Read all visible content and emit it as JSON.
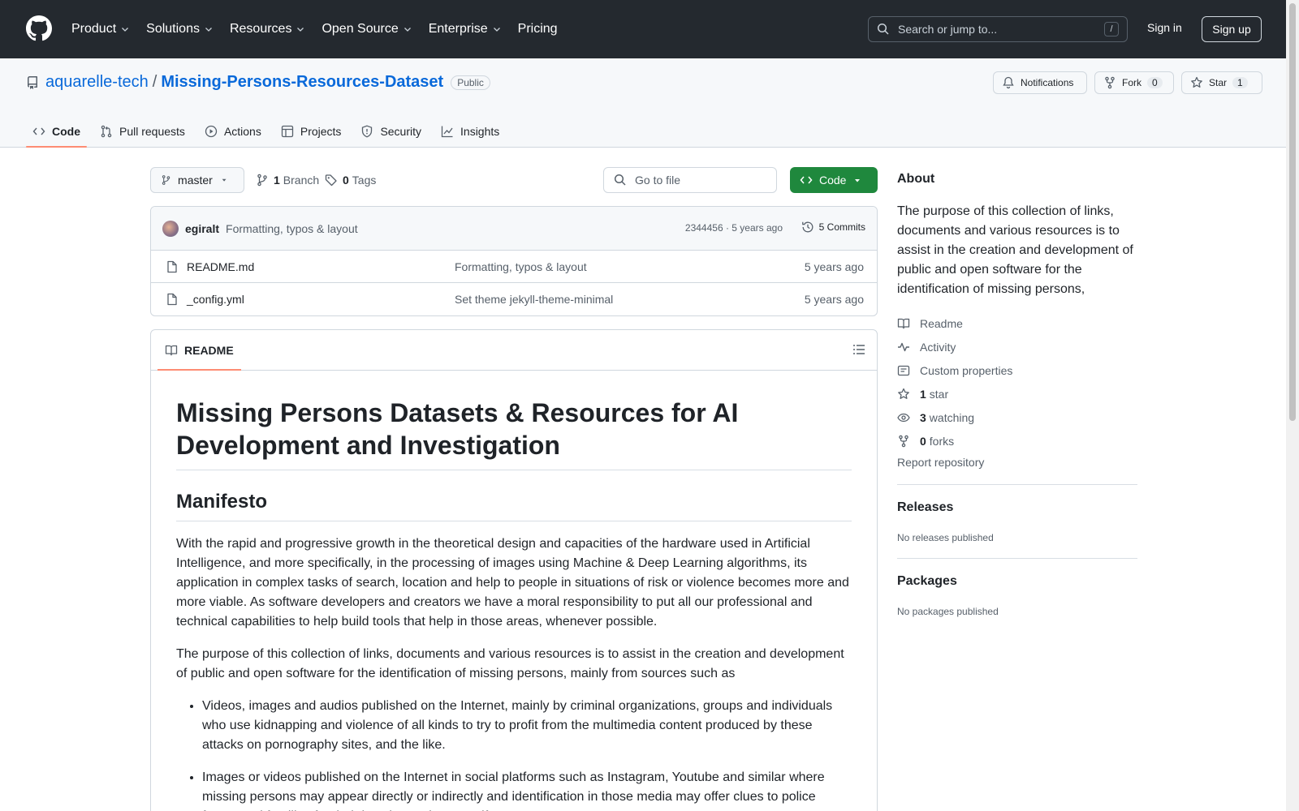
{
  "header": {
    "nav": [
      "Product",
      "Solutions",
      "Resources",
      "Open Source",
      "Enterprise",
      "Pricing"
    ],
    "search_placeholder": "Search or jump to...",
    "search_shortcut": "/",
    "signin": "Sign in",
    "signup": "Sign up"
  },
  "repo": {
    "owner": "aquarelle-tech",
    "separator": "/",
    "name": "Missing-Persons-Resources-Dataset",
    "visibility": "Public",
    "notifications_label": "Notifications",
    "fork_label": "Fork",
    "fork_count": "0",
    "star_label": "Star",
    "star_count": "1"
  },
  "tabs": [
    "Code",
    "Pull requests",
    "Actions",
    "Projects",
    "Security",
    "Insights"
  ],
  "toolbar": {
    "branch": "master",
    "branch_count": "1",
    "branch_label": "Branch",
    "tag_count": "0",
    "tag_label": "Tags",
    "gofile_placeholder": "Go to file",
    "code_label": "Code"
  },
  "commit": {
    "author": "egiralt",
    "message": "Formatting, typos & layout",
    "meta": "2344456 · 5 years ago",
    "count": "5 Commits"
  },
  "files": [
    {
      "name": "README.md",
      "message": "Formatting, typos & layout",
      "date": "5 years ago"
    },
    {
      "name": "_config.yml",
      "message": "Set theme jekyll-theme-minimal",
      "date": "5 years ago"
    }
  ],
  "readme": {
    "tab": "README",
    "h1": "Missing Persons Datasets & Resources for AI Development and Investigation",
    "h2": "Manifesto",
    "p1": "With the rapid and progressive growth in the theoretical design and capacities of the hardware used in Artificial Intelligence, and more specifically, in the processing of images using Machine & Deep Learning algorithms, its application in complex tasks of search, location and help to people in situations of risk or violence becomes more and more viable. As software developers and creators we have a moral responsibility to put all our professional and technical capabilities to help build tools that help in those areas, whenever possible.",
    "p2": "The purpose of this collection of links, documents and various resources is to assist in the creation and development of public and open software for the identification of missing persons, mainly from sources such as",
    "li1": "Videos, images and audios published on the Internet, mainly by criminal organizations, groups and individuals who use kidnapping and violence of all kinds to try to profit from the multimedia content produced by these attacks on pornography sites, and the like.",
    "li2": "Images or videos published on the Internet in social platforms such as Instagram, Youtube and similar where missing persons may appear directly or indirectly and identification in those media may offer clues to police forces and families for their location and rescue, if necessary."
  },
  "about": {
    "title": "About",
    "description": "The purpose of this collection of links, documents and various resources is to assist in the creation and development of public and open software for the identification of missing persons,",
    "readme": "Readme",
    "activity": "Activity",
    "custom_properties": "Custom properties",
    "stars_count": "1",
    "stars_label": "star",
    "watching_count": "3",
    "watching_label": "watching",
    "forks_count": "0",
    "forks_label": "forks",
    "report": "Report repository"
  },
  "releases": {
    "title": "Releases",
    "empty": "No releases published"
  },
  "packages": {
    "title": "Packages",
    "empty": "No packages published"
  }
}
